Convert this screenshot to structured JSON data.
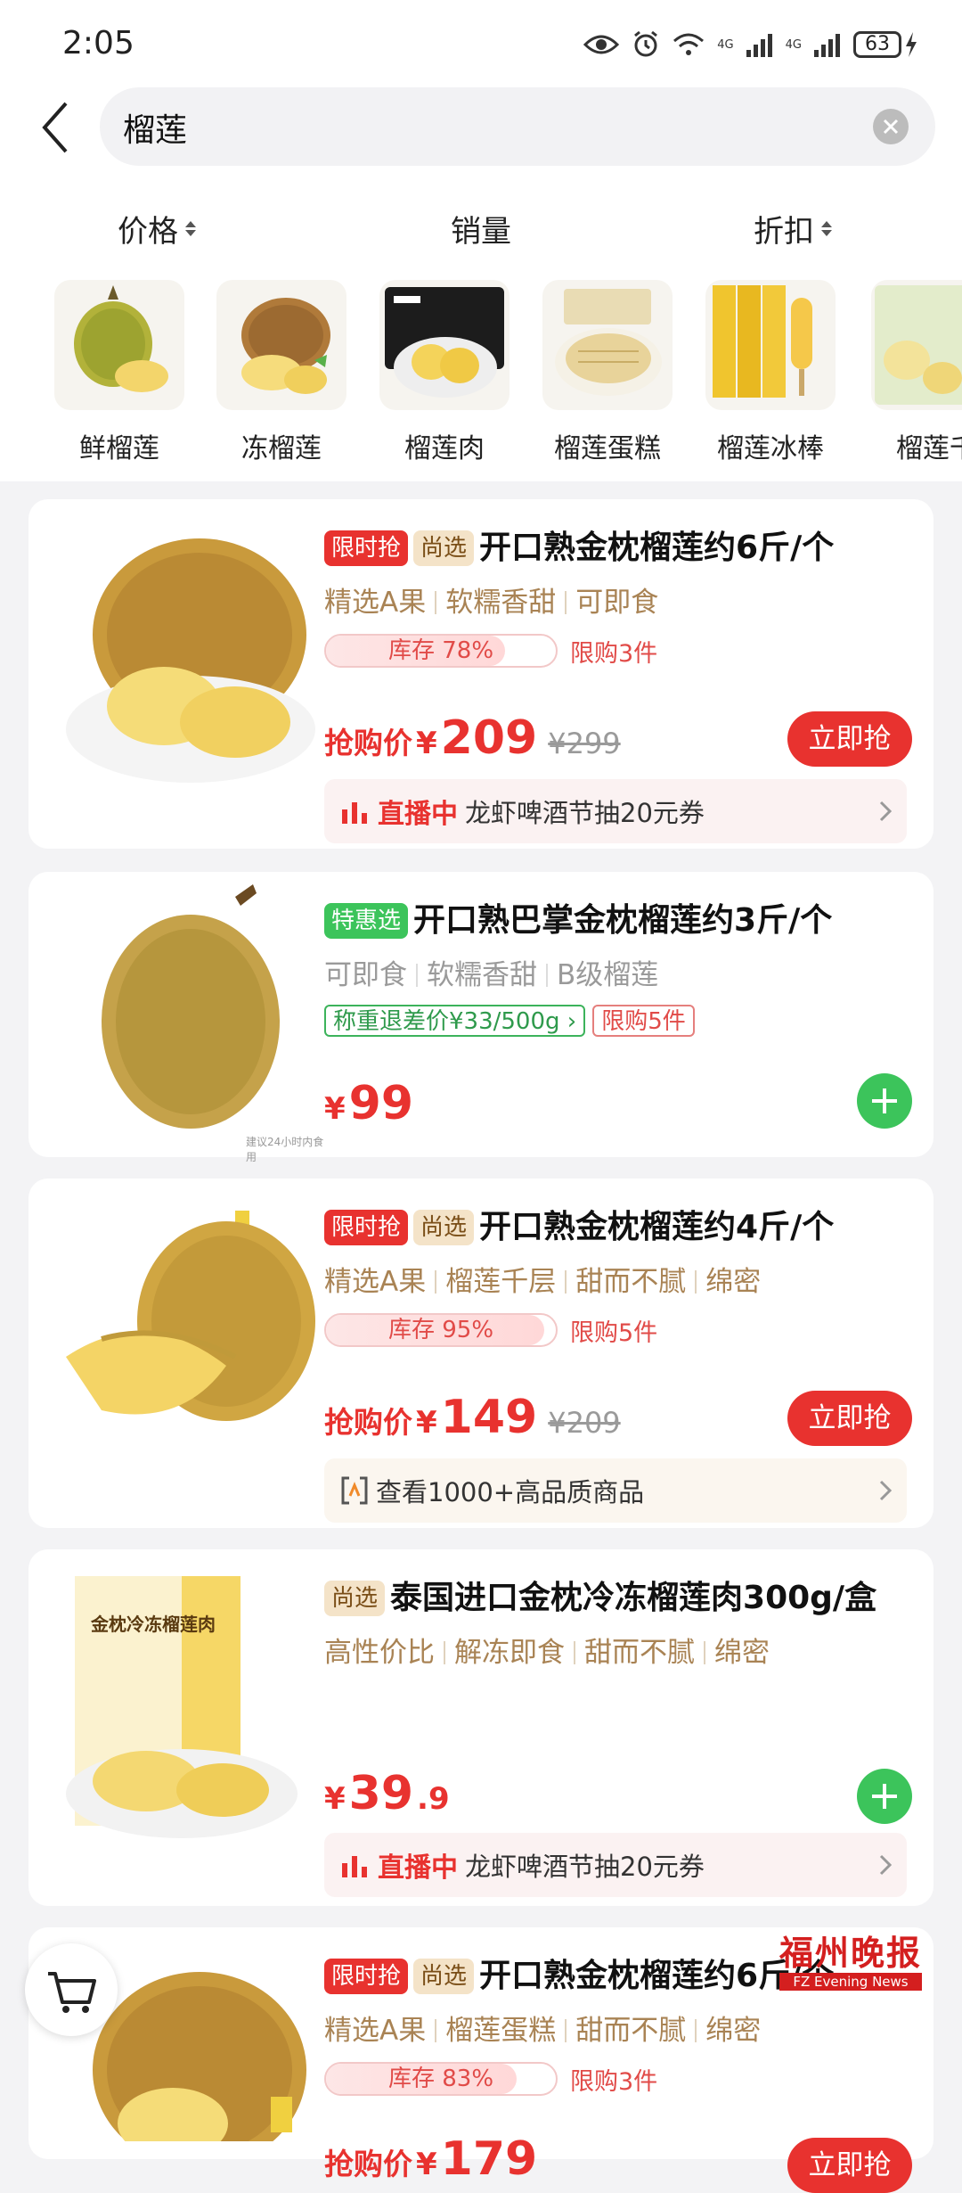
{
  "status_bar": {
    "time": "2:05",
    "battery": "63",
    "net1": "4G",
    "net2": "4G"
  },
  "search": {
    "query": "榴莲"
  },
  "sort": {
    "price": "价格",
    "sales": "销量",
    "discount": "折扣"
  },
  "categories": [
    {
      "label": "鲜榴莲"
    },
    {
      "label": "冻榴莲"
    },
    {
      "label": "榴莲肉"
    },
    {
      "label": "榴莲蛋糕"
    },
    {
      "label": "榴莲冰棒"
    },
    {
      "label": "榴莲千"
    }
  ],
  "products": [
    {
      "badges": [
        "限时抢",
        "尚选"
      ],
      "title": "开口熟金枕榴莲约6斤/个",
      "tags": [
        "精选A果",
        "软糯香甜",
        "可即食"
      ],
      "stock": "库存 78%",
      "stock_level": 0.78,
      "limit": "限购3件",
      "price_label": "抢购价",
      "currency": "¥",
      "price": "209",
      "original": "¥299",
      "buy": "立即抢",
      "promo_live": "直播中",
      "promo_text": "龙虾啤酒节抽20元券"
    },
    {
      "badge": "特惠选",
      "title": "开口熟巴掌金枕榴莲约3斤/个",
      "tags": [
        "可即食",
        "软糯香甜",
        "B级榴莲"
      ],
      "refund": "称重退差价|¥33/500g",
      "limit": "限购5件",
      "currency": "¥",
      "price": "99",
      "note": "建议24小时内食用"
    },
    {
      "badges": [
        "限时抢",
        "尚选"
      ],
      "title": "开口熟金枕榴莲约4斤/个",
      "tags": [
        "精选A果",
        "榴莲千层",
        "甜而不腻",
        "绵密"
      ],
      "stock": "库存 95%",
      "stock_level": 0.95,
      "limit": "限购5件",
      "price_label": "抢购价",
      "currency": "¥",
      "price": "149",
      "original": "¥209",
      "buy": "立即抢",
      "promo_text": "查看1000+高品质商品"
    },
    {
      "badge": "尚选",
      "title": "泰国进口金枕冷冻榴莲肉300g/盒",
      "box_label": "金枕冷冻榴莲肉",
      "tags": [
        "高性价比",
        "解冻即食",
        "甜而不腻",
        "绵密"
      ],
      "currency": "¥",
      "price": "39",
      "price_dec": ".9",
      "promo_live": "直播中",
      "promo_text": "龙虾啤酒节抽20元券"
    },
    {
      "badges": [
        "限时抢",
        "尚选"
      ],
      "title": "开口熟金枕榴莲约6斤/个",
      "tags": [
        "精选A果",
        "榴莲蛋糕",
        "甜而不腻",
        "绵密"
      ],
      "stock": "库存 83%",
      "stock_level": 0.83,
      "limit": "限购3件",
      "price_label": "抢购价",
      "currency": "¥",
      "price": "179",
      "buy": "立即抢"
    }
  ],
  "watermark": {
    "title": "福州晚报",
    "subtitle": "FZ Evening News"
  },
  "colors": {
    "accent_red": "#e8322f",
    "green": "#3cc45b",
    "tag_gold": "#a98354"
  }
}
